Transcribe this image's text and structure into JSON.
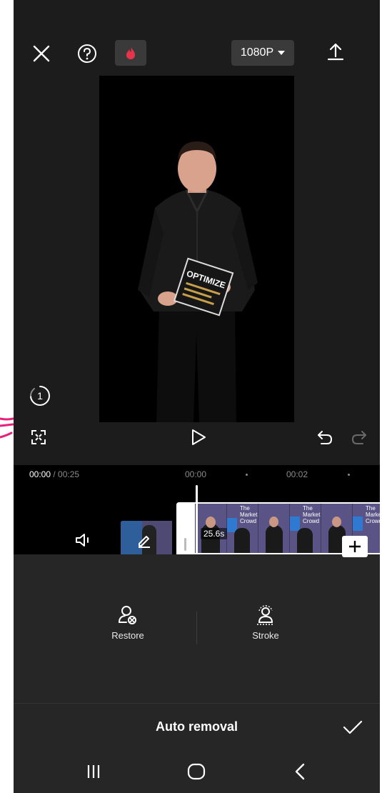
{
  "header": {
    "resolution_label": "1080P",
    "flame_color": "#e8344a"
  },
  "preview": {
    "book_title": "OPTIMIZE",
    "history_count": "1"
  },
  "timeline": {
    "current_time": "00:00",
    "total_time": "/ 00:25",
    "ticks": [
      "00:00",
      "00:02"
    ],
    "clip_duration": "25.6s",
    "thumb_text": [
      "The",
      "Marketing",
      "Crowd"
    ]
  },
  "tools": {
    "restore_label": "Restore",
    "stroke_label": "Stroke"
  },
  "bottom": {
    "title": "Auto removal"
  },
  "colors": {
    "background": "#1c1c1c",
    "panel": "#262626",
    "accent_annotation": "#e8207a"
  },
  "icons": [
    "close-icon",
    "help-icon",
    "flame-icon",
    "caret-down-icon",
    "export-icon",
    "history-icon",
    "fullscreen-icon",
    "play-icon",
    "undo-icon",
    "redo-icon",
    "volume-icon",
    "edit-icon",
    "add-icon",
    "restore-icon",
    "stroke-icon",
    "check-icon",
    "recents-icon",
    "home-icon",
    "back-icon"
  ]
}
